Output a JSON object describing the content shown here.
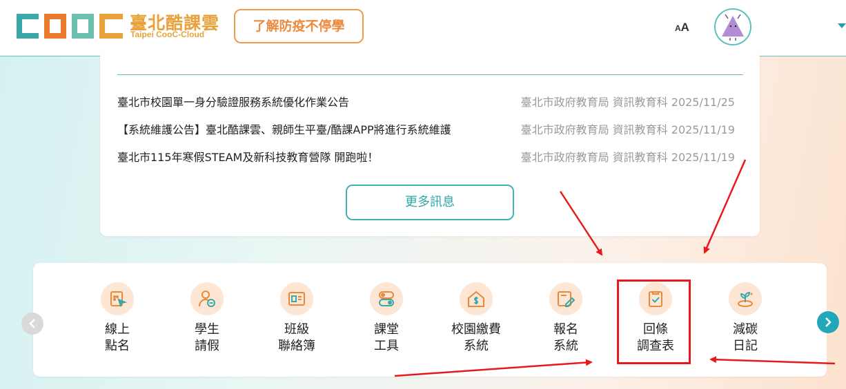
{
  "header": {
    "logo_cn": "臺北酷課雲",
    "logo_en": "Taipei CooC-Cloud",
    "covid_button": "了解防疫不停學",
    "font_size_small": "A",
    "font_size_large": "A",
    "avatar_icon": "triangle-creature-avatar",
    "dropdown_icon": "caret-down-icon",
    "colors": {
      "brand_orange": "#e9a23a",
      "teal": "#3aa8a8",
      "accent_blue": "#1e9bb3"
    }
  },
  "news": {
    "items": [
      {
        "title": "臺北市校園單一身分驗證服務系統優化作業公告",
        "meta": "臺北市政府教育局 資訊教育科 2025/11/25"
      },
      {
        "title": "【系統維護公告】臺北酷課雲、親師生平臺/酷課APP將進行系統維護",
        "meta": "臺北市政府教育局 資訊教育科 2025/11/19"
      },
      {
        "title": "臺北市115年寒假STEAM及新科技教育營隊 開跑啦！",
        "meta": "臺北市政府教育局 資訊教育科 2025/11/19"
      }
    ],
    "more_button": "更多訊息"
  },
  "features": {
    "items": [
      {
        "line1": "線上",
        "line2": "點名",
        "icon": "online-rollcall-icon"
      },
      {
        "line1": "學生",
        "line2": "請假",
        "icon": "student-leave-icon"
      },
      {
        "line1": "班級",
        "line2": "聯絡簿",
        "icon": "class-contact-book-icon"
      },
      {
        "line1": "課堂",
        "line2": "工具",
        "icon": "classroom-tools-icon"
      },
      {
        "line1": "校園繳費",
        "line2": "系統",
        "icon": "campus-payment-icon"
      },
      {
        "line1": "報名",
        "line2": "系統",
        "icon": "registration-icon"
      },
      {
        "line1": "回條",
        "line2": "調查表",
        "icon": "reply-survey-icon"
      },
      {
        "line1": "減碳",
        "line2": "日記",
        "icon": "carbon-diary-icon"
      }
    ],
    "prev_icon": "chevron-left-icon",
    "next_icon": "chevron-right-icon",
    "highlight_color": "#e8191c"
  }
}
